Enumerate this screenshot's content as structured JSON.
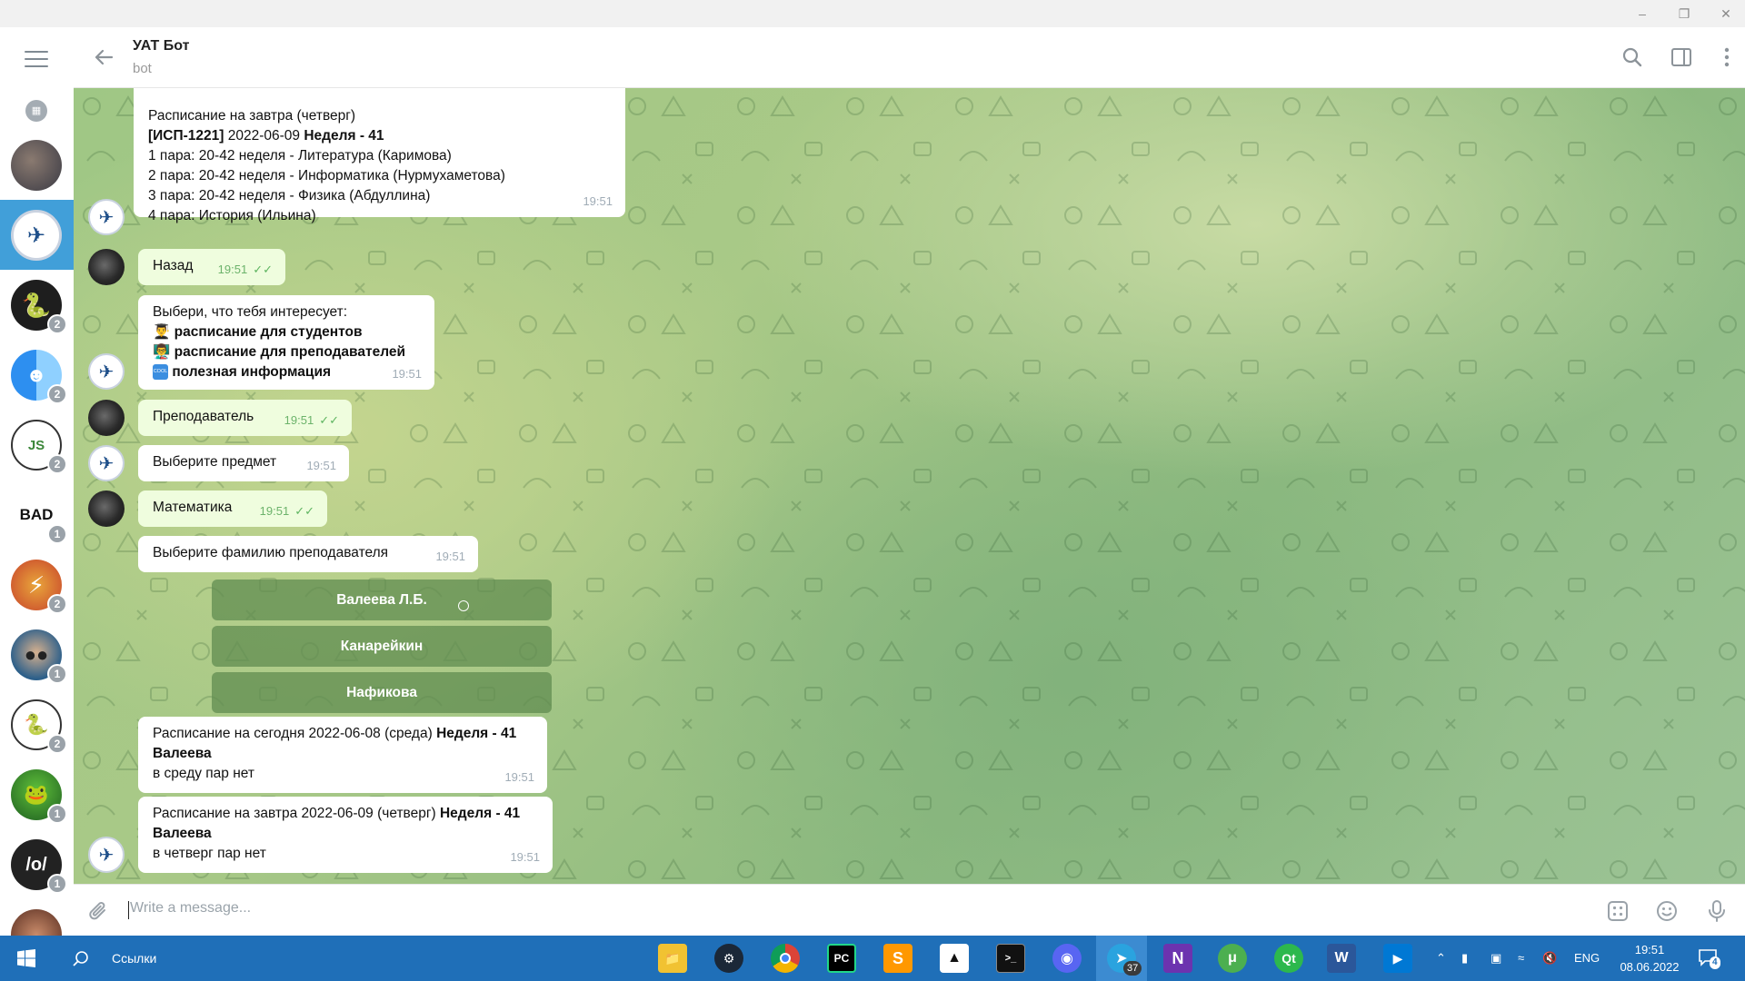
{
  "window": {
    "minimize_icon": "minimize-icon",
    "restore_icon": "restore-icon",
    "close_icon": "close-icon"
  },
  "sidebar": {
    "menu_icon": "hamburger-icon",
    "archive_icon": "archive-icon",
    "chats": [
      {
        "name": "chat-1",
        "badge": ""
      },
      {
        "name": "chat-uat-bot",
        "badge": "",
        "selected": true
      },
      {
        "name": "chat-python",
        "badge": "2"
      },
      {
        "name": "chat-finder",
        "badge": "2"
      },
      {
        "name": "chat-senior-frontender",
        "badge": "2"
      },
      {
        "name": "chat-bad-code",
        "badge": "1",
        "label": "BAD"
      },
      {
        "name": "chat-flash",
        "badge": "2"
      },
      {
        "name": "chat-avatar-glasses",
        "badge": "1"
      },
      {
        "name": "chat-senior-pythonist",
        "badge": "2"
      },
      {
        "name": "chat-snake",
        "badge": "1"
      },
      {
        "name": "chat-dev-null",
        "badge": "1",
        "label": "/o/"
      },
      {
        "name": "chat-hand",
        "badge": ""
      }
    ]
  },
  "header": {
    "title": "УАТ Бот",
    "subtitle": "bot"
  },
  "messages": {
    "m1": {
      "line1": "Расписание на завтра (четверг)",
      "line2_a": "[ИСП-1221]",
      "line2_b": " 2022-06-09 ",
      "line2_c": "Неделя - 41",
      "line3": "1 пара: 20-42 неделя - Литература (Каримова)",
      "line4": "2 пара: 20-42 неделя - Информатика (Нурмухаметова)",
      "line5": "3 пара: 20-42 неделя - Физика (Абдуллина)",
      "line6": "4 пара: История (Ильина)",
      "time": "19:51"
    },
    "m2": {
      "text": "Назад",
      "time": "19:51"
    },
    "m3": {
      "line1": "Выбери, что тебя интересует:",
      "opt1": "расписание для студентов",
      "opt2": "расписание для преподавателей",
      "opt3": "полезная информация",
      "cool": "COOL",
      "time": "19:51"
    },
    "m4": {
      "text": "Преподаватель",
      "time": "19:51"
    },
    "m5": {
      "text": "Выберите предмет",
      "time": "19:51"
    },
    "m6": {
      "text": "Математика",
      "time": "19:51"
    },
    "m7": {
      "text": "Выберите фамилию преподавателя",
      "time": "19:51"
    },
    "keyboard": [
      "Валеева Л.Б.",
      "Канарейкин",
      "Нафикова"
    ],
    "m8": {
      "a": "Расписание на сегодня 2022-06-08 (среда) ",
      "b": "Неделя - 41",
      "c": "Валеева",
      "d": "в среду пар нет",
      "time": "19:51"
    },
    "m9": {
      "a": "Расписание на завтра 2022-06-09 (четверг) ",
      "b": "Неделя - 41",
      "c": "Валеева",
      "d": "в четверг пар нет",
      "time": "19:51"
    }
  },
  "composer": {
    "placeholder": "Write a message..."
  },
  "taskbar": {
    "search_label": "Ссылки",
    "telegram_badge": "37",
    "lang": "ENG",
    "time": "19:51",
    "date": "08.06.2022",
    "notifications": "4"
  },
  "colors": {
    "accent": "#419fd9",
    "taskbar": "#1f6fb8",
    "outgoing_bubble": "#effdde",
    "incoming_bubble": "#ffffff"
  }
}
